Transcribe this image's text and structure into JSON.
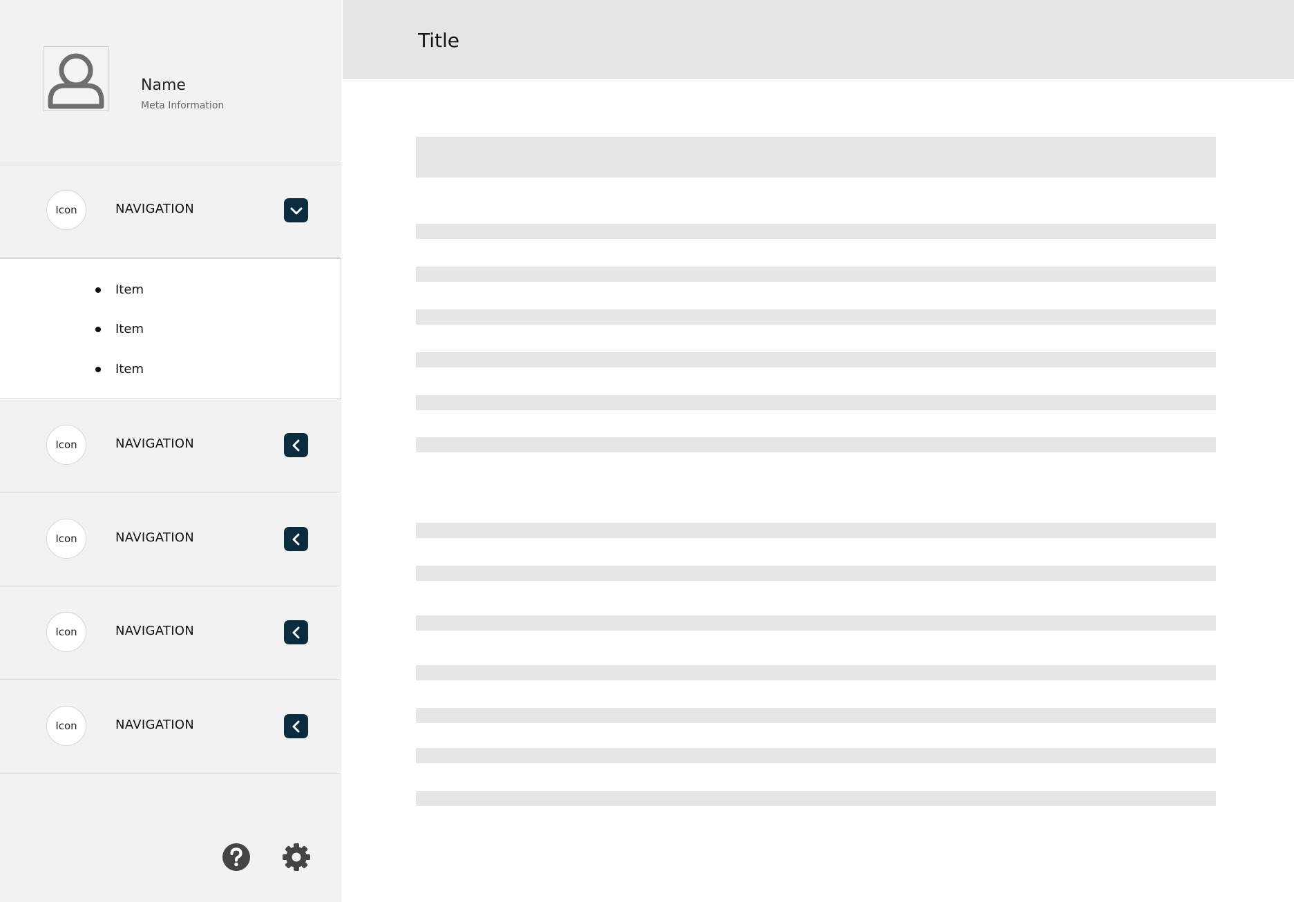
{
  "profile": {
    "name": "Name",
    "meta": "Meta Information",
    "avatar_icon": "user-icon"
  },
  "header": {
    "title": "Title"
  },
  "sidebar": {
    "nav_items": [
      {
        "icon_label": "Icon",
        "label": "NAVIGATION",
        "expanded": true,
        "toggle_icon": "chevron-down-icon"
      },
      {
        "icon_label": "Icon",
        "label": "NAVIGATION",
        "expanded": false,
        "toggle_icon": "chevron-left-icon"
      },
      {
        "icon_label": "Icon",
        "label": "NAVIGATION",
        "expanded": false,
        "toggle_icon": "chevron-left-icon"
      },
      {
        "icon_label": "Icon",
        "label": "NAVIGATION",
        "expanded": false,
        "toggle_icon": "chevron-left-icon"
      },
      {
        "icon_label": "Icon",
        "label": "NAVIGATION",
        "expanded": false,
        "toggle_icon": "chevron-left-icon"
      }
    ],
    "submenu_items": [
      {
        "label": "Item"
      },
      {
        "label": "Item"
      },
      {
        "label": "Item"
      }
    ],
    "footer_icons": [
      "help-icon",
      "settings-icon"
    ]
  },
  "colors": {
    "sidebar_bg": "#f2f2f2",
    "header_bg": "#e5e5e5",
    "placeholder": "#e5e5e5",
    "toggle_accent": "#0b2b3f",
    "footer_icon": "#444444"
  }
}
